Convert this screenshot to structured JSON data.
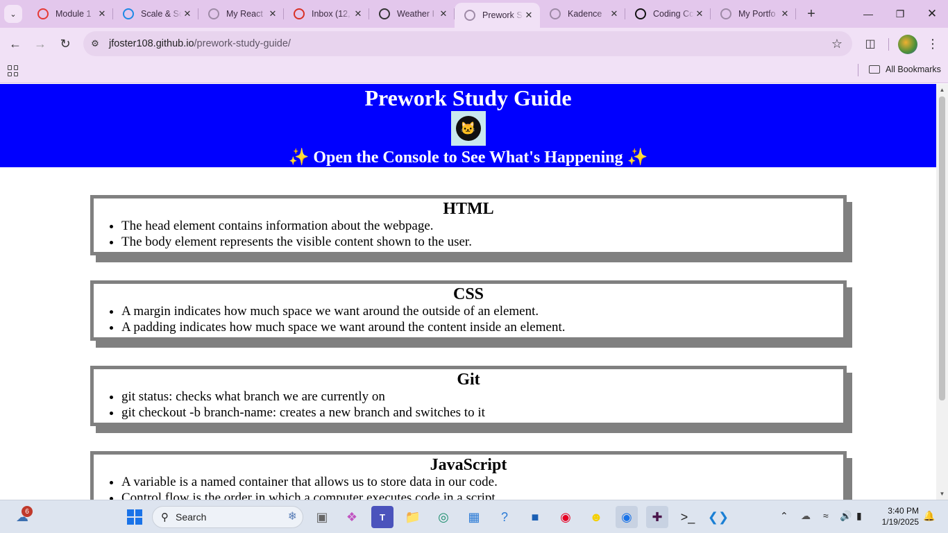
{
  "browser": {
    "tabs": [
      {
        "title": "Module 1",
        "favicon": "module-favicon",
        "color": "#e53935"
      },
      {
        "title": "Scale & Sc",
        "favicon": "scale-favicon",
        "color": "#1e88e5"
      },
      {
        "title": "My React",
        "favicon": "globe-favicon",
        "color": "#9e8aa6"
      },
      {
        "title": "Inbox (12,",
        "favicon": "gmail-favicon",
        "color": "#d93025"
      },
      {
        "title": "Weather I",
        "favicon": "link-favicon",
        "color": "#333333"
      },
      {
        "title": "Prework S",
        "favicon": "globe-favicon",
        "color": "#9e8aa6",
        "active": true
      },
      {
        "title": "Kadence",
        "favicon": "globe-favicon",
        "color": "#9e8aa6"
      },
      {
        "title": "Coding Cc",
        "favicon": "chatgpt-favicon",
        "color": "#111111"
      },
      {
        "title": "My Portfo",
        "favicon": "globe-favicon",
        "color": "#9e8aa6"
      }
    ],
    "url": {
      "host": "jfoster108.github.io",
      "path": "/prework-study-guide/"
    },
    "bookmarks": {
      "all_label": "All Bookmarks"
    }
  },
  "page": {
    "title": "Prework Study Guide",
    "subtitle": "✨ Open the Console to See What's Happening ✨",
    "colors": {
      "header_bg": "#0000ff",
      "card_border": "#808080"
    },
    "sections": [
      {
        "heading": "HTML",
        "items": [
          "The head element contains information about the webpage.",
          "The body element represents the visible content shown to the user."
        ]
      },
      {
        "heading": "CSS",
        "items": [
          "A margin indicates how much space we want around the outside of an element.",
          "A padding indicates how much space we want around the content inside an element."
        ]
      },
      {
        "heading": "Git",
        "items": [
          "git status: checks what branch we are currently on",
          "git checkout -b branch-name: creates a new branch and switches to it"
        ]
      },
      {
        "heading": "JavaScript",
        "items": [
          "A variable is a named container that allows us to store data in our code.",
          "Control flow is the order in which a computer executes code in a script."
        ]
      }
    ]
  },
  "taskbar": {
    "search_placeholder": "Search",
    "widget_badge": "6",
    "time": "3:40 PM",
    "date": "1/19/2025"
  }
}
